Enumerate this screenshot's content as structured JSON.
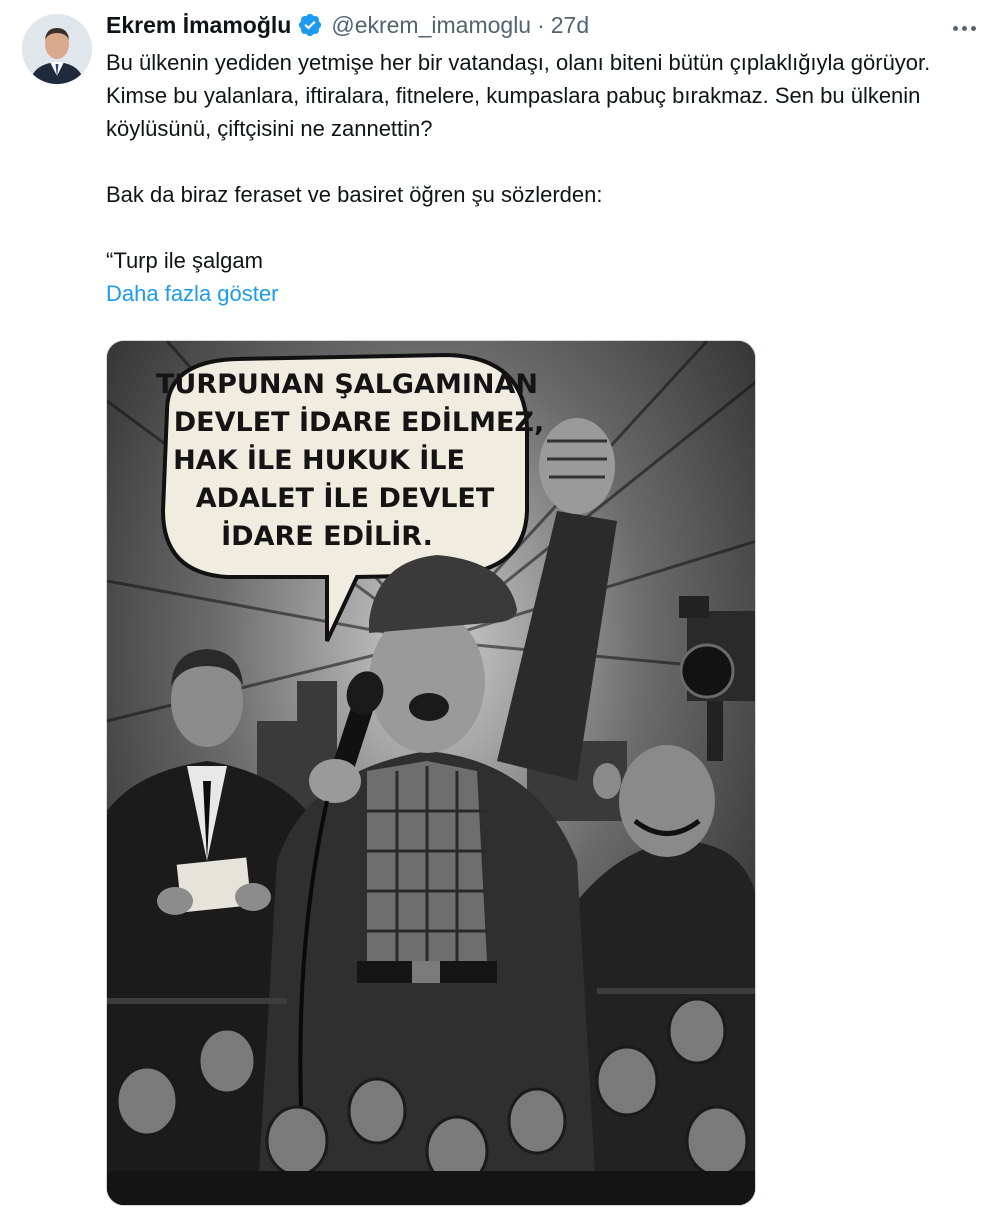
{
  "author": {
    "name": "Ekrem İmamoğlu",
    "handle": "@ekrem_imamoglu",
    "separator": "·",
    "time": "27d",
    "verified": true
  },
  "tweet": {
    "paragraph1": "Bu ülkenin yediden yetmişe her bir vatandaşı, olanı biteni bütün çıplaklığıyla görüyor. Kimse bu yalanlara, iftiralara, fitnelere, kumpaslara pabuç bırakmaz. Sen bu ülkenin köylüsünü, çiftçisini ne zannettin?",
    "paragraph2": "Bak da biraz feraset ve basiret öğren şu sözlerden:",
    "paragraph3": "“Turp ile şalgam",
    "show_more": "Daha fazla göster"
  },
  "media": {
    "speech_bubble": {
      "line1": "TURPUNAN ŞALGAMINAN",
      "line2": "DEVLET İDARE EDİLMEZ,",
      "line3": "HAK İLE HUKUK İLE",
      "line4": "ADALET İLE DEVLET",
      "line5": "İDARE EDİLİR."
    }
  },
  "colors": {
    "link": "#1d9bf0",
    "verified": "#1d9bf0",
    "secondary_text": "#536471"
  },
  "icons": {
    "verified": "verified-badge-icon",
    "more": "more-options-icon"
  }
}
